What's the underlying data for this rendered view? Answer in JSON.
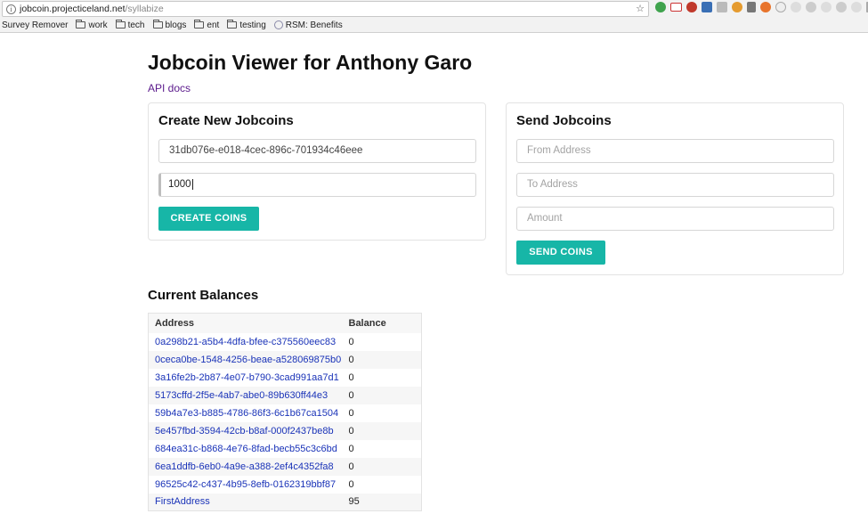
{
  "browser": {
    "url_host": "jobcoin.projecticeland.net",
    "url_path": "/syllabize",
    "bookmarks": [
      "Survey Remover",
      "work",
      "tech",
      "blogs",
      "ent",
      "testing",
      "RSM: Benefits"
    ]
  },
  "header": {
    "title": "Jobcoin Viewer for Anthony Garo",
    "api_link": "API docs"
  },
  "create": {
    "title": "Create New Jobcoins",
    "address_value": "31db076e-e018-4cec-896c-701934c46eee",
    "amount_value": "1000",
    "button_label": "CREATE COINS"
  },
  "send": {
    "title": "Send Jobcoins",
    "from_placeholder": "From Address",
    "to_placeholder": "To Address",
    "amount_placeholder": "Amount",
    "button_label": "SEND COINS"
  },
  "balances": {
    "title": "Current Balances",
    "columns": [
      "Address",
      "Balance"
    ],
    "rows": [
      {
        "address": "0a298b21-a5b4-4dfa-bfee-c375560eec83",
        "balance": "0"
      },
      {
        "address": "0ceca0be-1548-4256-beae-a528069875b0",
        "balance": "0"
      },
      {
        "address": "3a16fe2b-2b87-4e07-b790-3cad991aa7d1",
        "balance": "0"
      },
      {
        "address": "5173cffd-2f5e-4ab7-abe0-89b630ff44e3",
        "balance": "0"
      },
      {
        "address": "59b4a7e3-b885-4786-86f3-6c1b67ca1504",
        "balance": "0"
      },
      {
        "address": "5e457fbd-3594-42cb-b8af-000f2437be8b",
        "balance": "0"
      },
      {
        "address": "684ea31c-b868-4e76-8fad-becb55c3c6bd",
        "balance": "0"
      },
      {
        "address": "6ea1ddfb-6eb0-4a9e-a388-2ef4c4352fa8",
        "balance": "0"
      },
      {
        "address": "96525c42-c437-4b95-8efb-0162319bbf87",
        "balance": "0"
      },
      {
        "address": "FirstAddress",
        "balance": "95"
      }
    ]
  },
  "colors": {
    "accent": "#17b6a7",
    "link": "#1a33b8",
    "visited_link": "#5b1a8c"
  }
}
